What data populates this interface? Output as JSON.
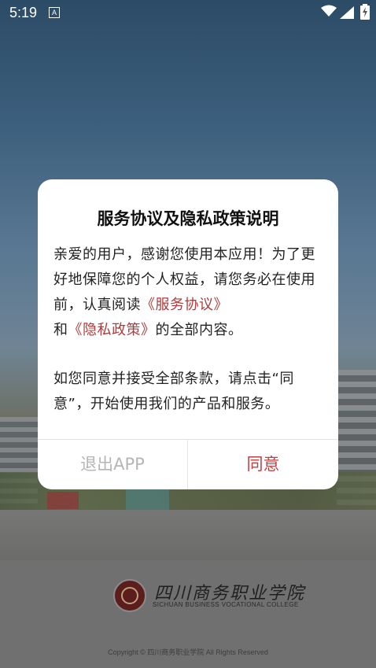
{
  "status_bar": {
    "time": "5:19",
    "notification_icon_letter": "A",
    "icons": [
      "wifi-icon",
      "cell-signal-icon",
      "battery-charging-icon"
    ]
  },
  "dialog": {
    "title": "服务协议及隐私政策说明",
    "para1_text_a": "亲爱的用户，感谢您使用本应用！为了更好地保障您的个人权益，请您务必在使用前，认真阅读",
    "service_link": "《服务协议》",
    "para1_text_b": "和",
    "privacy_link": "《隐私政策》",
    "para1_text_c": "的全部内容。",
    "para2": "如您同意并接受全部条款，请点击“同意”，开始使用我们的产品和服务。",
    "exit_button": "退出APP",
    "agree_button": "同意",
    "colors": {
      "link": "#b23a3a",
      "agree": "#c04040",
      "exit": "#b5b5b5"
    }
  },
  "branding": {
    "college_name_cn": "四川商务职业学院",
    "college_name_en": "SICHUAN BUSINESS VOCATIONAL COLLEGE",
    "copyright": "Copyright © 四川商务职业学院 All Rights Reserved"
  }
}
